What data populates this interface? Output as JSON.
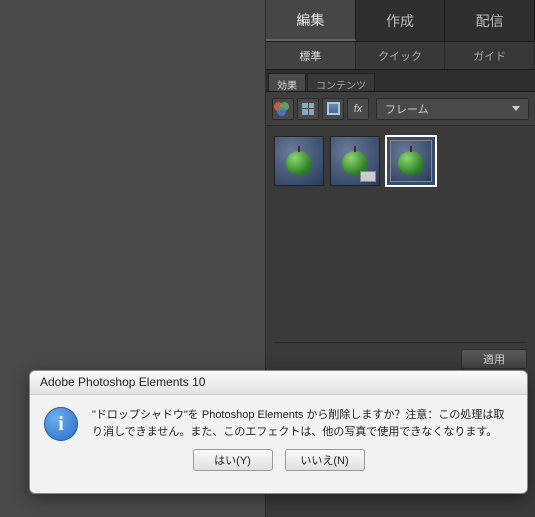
{
  "top_tabs": {
    "edit": "編集",
    "create": "作成",
    "deliver": "配信"
  },
  "sub_tabs": {
    "standard": "標準",
    "quick": "クイック",
    "guide": "ガイド"
  },
  "panel_tabs": {
    "effects": "効果",
    "contents": "コンテンツ"
  },
  "dropdown": {
    "selected": "フレーム"
  },
  "apply_label": "適用",
  "dialog": {
    "title": "Adobe Photoshop Elements 10",
    "message": "\"ドロップシャドウ\"を Photoshop Elements から削除しますか？注意：この処理は取り消しできません。また、このエフェクトは、他の写真で使用できなくなります。",
    "yes": "はい(Y)",
    "no": "いいえ(N)"
  }
}
